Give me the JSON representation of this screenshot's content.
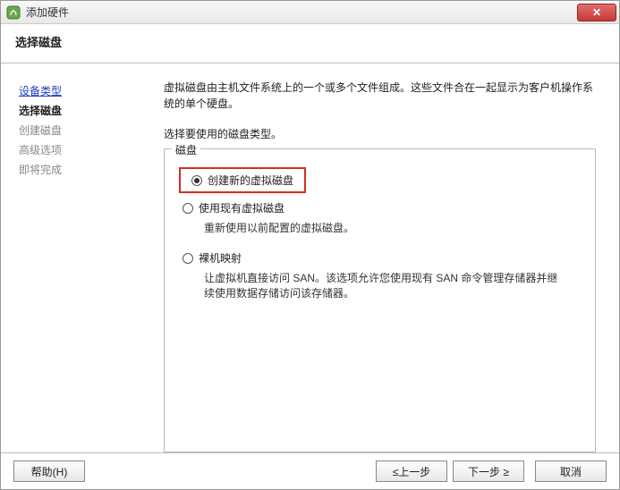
{
  "window": {
    "title": "添加硬件"
  },
  "header": {
    "subtitle": "选择磁盘"
  },
  "sidebar": {
    "steps": [
      {
        "label": "设备类型",
        "state": "link"
      },
      {
        "label": "选择磁盘",
        "state": "current"
      },
      {
        "label": "创建磁盘",
        "state": "inactive"
      },
      {
        "label": "高级选项",
        "state": "inactive"
      },
      {
        "label": "即将完成",
        "state": "inactive"
      }
    ]
  },
  "content": {
    "description": "虚拟磁盘由主机文件系统上的一个或多个文件组成。这些文件合在一起显示为客户机操作系统的单个硬盘。",
    "prompt": "选择要使用的磁盘类型。",
    "group_label": "磁盘",
    "options": [
      {
        "label": "创建新的虚拟磁盘",
        "desc": "",
        "selected": true,
        "highlight": true
      },
      {
        "label": "使用现有虚拟磁盘",
        "desc": "重新使用以前配置的虚拟磁盘。",
        "selected": false,
        "highlight": false
      },
      {
        "label": "裸机映射",
        "desc": "让虚拟机直接访问 SAN。该选项允许您使用现有 SAN 命令管理存储器并继续使用数据存储访问该存储器。",
        "selected": false,
        "highlight": false
      }
    ]
  },
  "footer": {
    "help": "帮助(H)",
    "back": "≤上一步",
    "next": "下一步 ≥",
    "cancel": "取消"
  }
}
